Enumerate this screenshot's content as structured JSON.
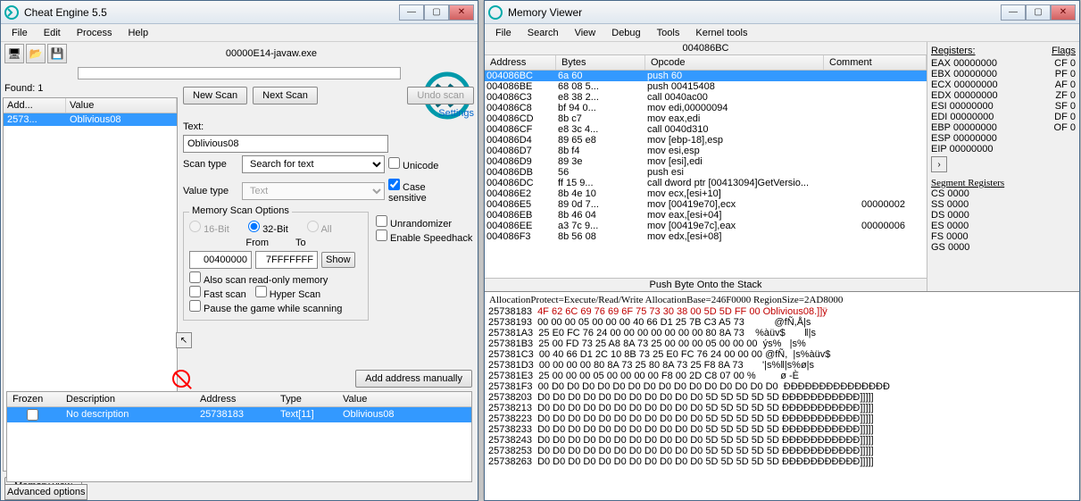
{
  "ce": {
    "title": "Cheat Engine 5.5",
    "menu": [
      "File",
      "Edit",
      "Process",
      "Help"
    ],
    "process": "00000E14-javaw.exe",
    "found_label": "Found: 1",
    "result_hdr": {
      "addr": "Add...",
      "value": "Value"
    },
    "result_row": {
      "addr": "2573...",
      "value": "Oblivious08"
    },
    "new_scan": "New Scan",
    "next_scan": "Next Scan",
    "undo_scan": "Undo scan",
    "settings": "Settings",
    "text_label": "Text:",
    "text_value": "Oblivious08",
    "scantype_label": "Scan type",
    "scantype_value": "Search for text",
    "valuetype_label": "Value type",
    "valuetype_value": "Text",
    "unicode": "Unicode",
    "casesens": "Case sensitive",
    "memopts": "Memory Scan Options",
    "bit16": "16-Bit",
    "bit32": "32-Bit",
    "bitall": "All",
    "from": "From",
    "to": "To",
    "from_v": "00400000",
    "to_v": "7FFFFFFF",
    "show": "Show",
    "readonly": "Also scan read-only memory",
    "fastscan": "Fast scan",
    "hyperscan": "Hyper Scan",
    "pausegame": "Pause the game while scanning",
    "unrand": "Unrandomizer",
    "speedhack": "Enable Speedhack",
    "memview": "Memory view",
    "addmanual": "Add address manually",
    "tbl_hdr": {
      "frozen": "Frozen",
      "desc": "Description",
      "addr": "Address",
      "type": "Type",
      "value": "Value"
    },
    "tbl_row": {
      "desc": "No description",
      "addr": "25738183",
      "type": "Text[11]",
      "value": "Oblivious08"
    },
    "advopt": "Advanced options"
  },
  "mv": {
    "title": "Memory Viewer",
    "menu": [
      "File",
      "Search",
      "View",
      "Debug",
      "Tools",
      "Kernel tools"
    ],
    "cur_addr": "004086BC",
    "cols": {
      "addr": "Address",
      "bytes": "Bytes",
      "opcode": "Opcode",
      "comment": "Comment"
    },
    "rows": [
      {
        "a": "004086BC",
        "b": "6a 60     ",
        "o": "push 60",
        "c": "",
        "sel": true
      },
      {
        "a": "004086BE",
        "b": "68 08 5...",
        "o": "push 00415408",
        "c": ""
      },
      {
        "a": "004086C3",
        "b": "e8 38 2...",
        "o": "call 0040ac00",
        "c": ""
      },
      {
        "a": "004086C8",
        "b": "bf 94 0...",
        "o": "mov edi,00000094",
        "c": ""
      },
      {
        "a": "004086CD",
        "b": "8b c7     ",
        "o": "mov eax,edi",
        "c": ""
      },
      {
        "a": "004086CF",
        "b": "e8 3c 4...",
        "o": "call 0040d310",
        "c": ""
      },
      {
        "a": "004086D4",
        "b": "89 65 e8  ",
        "o": "mov [ebp-18],esp",
        "c": ""
      },
      {
        "a": "004086D7",
        "b": "8b f4     ",
        "o": "mov esi,esp",
        "c": ""
      },
      {
        "a": "004086D9",
        "b": "89 3e     ",
        "o": "mov [esi],edi",
        "c": ""
      },
      {
        "a": "004086DB",
        "b": "56        ",
        "o": "push esi",
        "c": ""
      },
      {
        "a": "004086DC",
        "b": "ff 15 9...",
        "o": "call dword ptr [00413094]GetVersio...",
        "c": ""
      },
      {
        "a": "004086E2",
        "b": "8b 4e 10  ",
        "o": "mov ecx,[esi+10]",
        "c": ""
      },
      {
        "a": "004086E5",
        "b": "89 0d 7...",
        "o": "mov [00419e70],ecx",
        "c": "00000002"
      },
      {
        "a": "004086EB",
        "b": "8b 46 04  ",
        "o": "mov eax,[esi+04]",
        "c": ""
      },
      {
        "a": "004086EE",
        "b": "a3 7c 9...",
        "o": "mov [00419e7c],eax",
        "c": "00000006"
      },
      {
        "a": "004086F3",
        "b": "8b 56 08  ",
        "o": "mov edx,[esi+08]",
        "c": ""
      }
    ],
    "stackinfo": "Push Byte Onto the Stack",
    "reg_hdr": "Registers:",
    "flag_hdr": "Flags",
    "regs": [
      {
        "n": "EAX",
        "v": "00000000",
        "f": "CF 0"
      },
      {
        "n": "EBX",
        "v": "00000000",
        "f": "PF 0"
      },
      {
        "n": "ECX",
        "v": "00000000",
        "f": "AF 0"
      },
      {
        "n": "EDX",
        "v": "00000000",
        "f": "ZF 0"
      },
      {
        "n": "ESI",
        "v": "00000000",
        "f": "SF 0"
      },
      {
        "n": "EDI",
        "v": "00000000",
        "f": "DF 0"
      },
      {
        "n": "EBP",
        "v": "00000000",
        "f": "OF 0"
      },
      {
        "n": "ESP",
        "v": "00000000",
        "f": ""
      },
      {
        "n": "EIP",
        "v": "00000000",
        "f": ""
      }
    ],
    "seg_hdr": "Segment Registers",
    "segs": [
      "CS 0000",
      "SS 0000",
      "DS 0000",
      "ES 0000",
      "FS 0000",
      "GS 0000"
    ],
    "hexinfo": "AllocationProtect=Execute/Read/Write  AllocationBase=246F0000  RegionSize=2AD8000",
    "hexrows": [
      {
        "a": "25738183",
        "h": "4F 62 6C 69 76 69 6F 75 73 30 38 00 5D 5D FF 00",
        "t": "Oblivious08.]]ÿ",
        "red": true
      },
      {
        "a": "25738193",
        "h": "00 00 00 05 00 00 00 40 66 D1 25 7B C3 A5 73   ",
        "t": "       @fÑ,Å|s"
      },
      {
        "a": "257381A3",
        "h": "25 E0 FC 76 24 00 00 00 00 00 00 00 80 8A 73   ",
        "t": "%àüv$       ‖|s"
      },
      {
        "a": "257381B3",
        "h": "25 00 FD 73 25 A8 8A 73 25 00 00 00 05 00 00 00",
        "t": " ýs%   |s%"
      },
      {
        "a": "257381C3",
        "h": "00 40 66 D1 2C 10 8B 73 25 E0 FC 76 24 00 00 00",
        "t": "@fÑ,  |s%àüv$"
      },
      {
        "a": "257381D3",
        "h": "00 00 00 00 80 8A 73 25 80 8A 73 25 F8 8A 73   ",
        "t": "   '|s%‖|s%ø|s"
      },
      {
        "a": "257381E3",
        "h": "25 00 00 00 05 00 00 00 00 F8 00 2D C8 07 00 %",
        "t": "        ø -È"
      },
      {
        "a": "257381F3",
        "h": "00 D0 D0 D0 D0 D0 D0 D0 D0 D0 D0 D0 D0 D0 D0 D0",
        "t": " ÐÐÐÐÐÐÐÐÐÐÐÐÐÐÐ"
      },
      {
        "a": "25738203",
        "h": "D0 D0 D0 D0 D0 D0 D0 D0 D0 D0 D0 5D 5D 5D 5D 5D",
        "t": "ÐÐÐÐÐÐÐÐÐÐÐ]]]]]"
      },
      {
        "a": "25738213",
        "h": "D0 D0 D0 D0 D0 D0 D0 D0 D0 D0 D0 5D 5D 5D 5D 5D",
        "t": "ÐÐÐÐÐÐÐÐÐÐÐ]]]]]"
      },
      {
        "a": "25738223",
        "h": "D0 D0 D0 D0 D0 D0 D0 D0 D0 D0 D0 5D 5D 5D 5D 5D",
        "t": "ÐÐÐÐÐÐÐÐÐÐÐ]]]]]"
      },
      {
        "a": "25738233",
        "h": "D0 D0 D0 D0 D0 D0 D0 D0 D0 D0 D0 5D 5D 5D 5D 5D",
        "t": "ÐÐÐÐÐÐÐÐÐÐÐ]]]]]"
      },
      {
        "a": "25738243",
        "h": "D0 D0 D0 D0 D0 D0 D0 D0 D0 D0 D0 5D 5D 5D 5D 5D",
        "t": "ÐÐÐÐÐÐÐÐÐÐÐ]]]]]"
      },
      {
        "a": "25738253",
        "h": "D0 D0 D0 D0 D0 D0 D0 D0 D0 D0 D0 5D 5D 5D 5D 5D",
        "t": "ÐÐÐÐÐÐÐÐÐÐÐ]]]]]"
      },
      {
        "a": "25738263",
        "h": "D0 D0 D0 D0 D0 D0 D0 D0 D0 D0 D0 5D 5D 5D 5D 5D",
        "t": "ÐÐÐÐÐÐÐÐÐÐÐ]]]]]"
      }
    ]
  }
}
